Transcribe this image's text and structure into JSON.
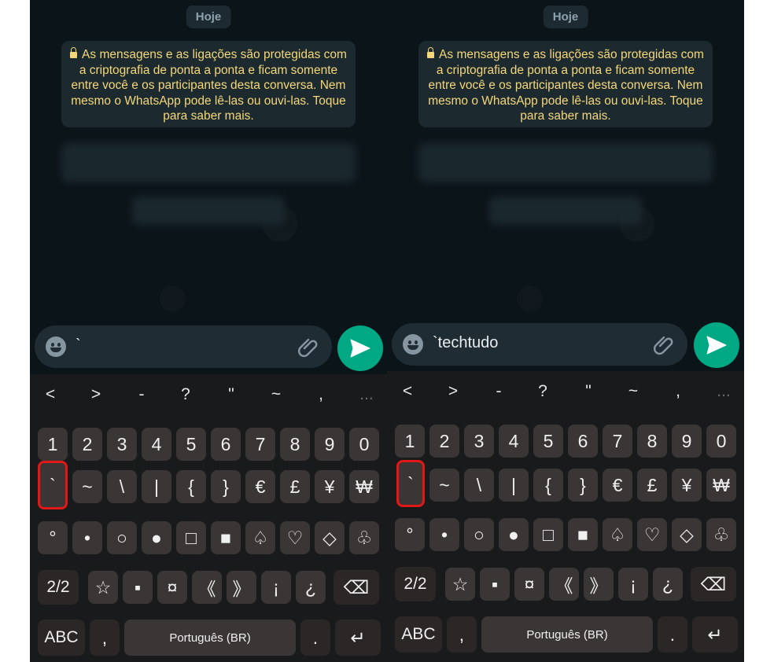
{
  "panels": [
    {
      "date_chip": "Hoje",
      "notice_text": "As mensagens e as ligações são protegidas com a criptografia de ponta a ponta e ficam somente entre você e os participantes desta conversa. Nem mesmo o WhatsApp pode lê-las ou ouvi-las. Toque para saber mais.",
      "input_value": "`"
    },
    {
      "date_chip": "Hoje",
      "notice_text": "As mensagens e as ligações são protegidas com a criptografia de ponta a ponta e ficam somente entre você e os participantes desta conversa. Nem mesmo o WhatsApp pode lê-las ou ouvi-las. Toque para saber mais.",
      "input_value": "`techtudo"
    }
  ],
  "keyboard": {
    "suggestions": [
      "<",
      ">",
      "-",
      "?",
      "\"",
      "~",
      ",",
      "..."
    ],
    "row1": [
      "1",
      "2",
      "3",
      "4",
      "5",
      "6",
      "7",
      "8",
      "9",
      "0"
    ],
    "row2": [
      "`",
      "~",
      "\\",
      "|",
      "{",
      "}",
      "€",
      "£",
      "¥",
      "₩"
    ],
    "row3": [
      "°",
      "•",
      "○",
      "●",
      "□",
      "■",
      "♤",
      "♡",
      "◇",
      "♧"
    ],
    "row4": [
      "2/2",
      "☆",
      "▪",
      "¤",
      "《",
      "》",
      "¡",
      "¿",
      "⌫"
    ],
    "row5": [
      "ABC",
      ",",
      "Português (BR)",
      ".",
      "↵"
    ],
    "highlighted_key": "`"
  },
  "colors": {
    "accent": "#00a884",
    "notice_text": "#f4d77a",
    "highlight": "#e11818"
  }
}
